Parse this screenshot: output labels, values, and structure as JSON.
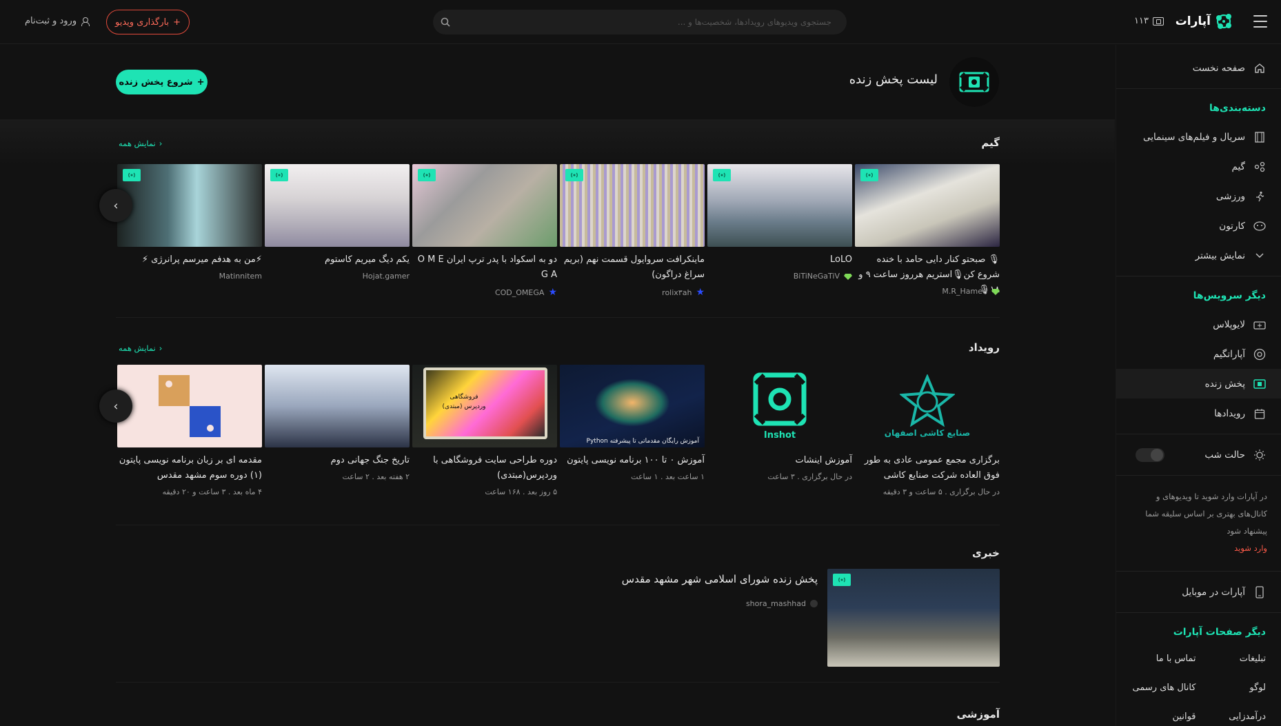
{
  "header": {
    "logo_text": "آپارات",
    "live_count": "۱۱۳",
    "search_placeholder": "جستجوی ویدیوهای رویدادها، شخصیت‌ها و ...",
    "upload_label": "بارگذاری ویدیو",
    "login_label": "ورود و ثبت‌نام"
  },
  "sidebar": {
    "home": "صفحه نخست",
    "categories_heading": "دسته‌بندی‌ها",
    "categories": [
      "سریال و فیلم‌های سینمایی",
      "گیم",
      "ورزشی",
      "کارتون"
    ],
    "show_more": "نمایش بیشتر",
    "services_heading": "دیگر سرویس‌ها",
    "services": [
      "لایوپلاس",
      "آپاراتگیم",
      "پخش زنده",
      "رویدادها"
    ],
    "dark_mode": "حالت شب",
    "note": "در آپارات وارد شوید تا ویدیوهای و کانال‌های بهتری بر اساس سلیقه شما پیشنهاد شود",
    "note_login": "وارد شوید",
    "mobile": "آپارات در موبایل",
    "pages_heading": "دیگر صفحات آپارات",
    "pages": [
      "تبلیغات",
      "تماس با ما",
      "لوگو",
      "کانال های رسمی",
      "درآمدزایی",
      "قوانین"
    ]
  },
  "page": {
    "title": "لیست پخش زنده",
    "start_live": "شروع پخش زنده",
    "show_all": "نمایش همه"
  },
  "sections": {
    "game": {
      "title": "گیم",
      "cards": [
        {
          "title": "🎙 صبحتو کنار دایی حامد با خنده شروع کن🎙استریم هرروز ساعت ۹ و ۱۸🎙",
          "channel": "M.R_Hamed",
          "badge": "gem"
        },
        {
          "title": "LoLO",
          "channel": "BiTiNeGaTiV",
          "badge": "gem"
        },
        {
          "title": "ماینکرافت سروایول قسمت نهم (بریم سراغ دراگون)",
          "channel": "rolix۳ah",
          "badge": "star"
        },
        {
          "title": "دو به اسکواد با پدر ترپ ایران O M E G A",
          "channel": "COD_OMEGA",
          "badge": "star"
        },
        {
          "title": "یکم دیگ میریم کاستوم",
          "channel": "Hojat.gamer",
          "badge": ""
        },
        {
          "title": "⚡من به هدفم میرسم پرانرژی ⚡",
          "channel": "Matinnitem",
          "badge": ""
        }
      ]
    },
    "event": {
      "title": "رویداد",
      "cards": [
        {
          "title": "برگزاری مجمع عمومی عادی به طور فوق العاده شرکت صنایع کاشی",
          "meta": "در حال برگزاری  .  ۵ ساعت و ۳ دقیقه",
          "thumb_text": "صنایع کاشی اصفهان"
        },
        {
          "title": "آموزش اینشات",
          "meta": "در حال برگزاری  .  ۳ ساعت",
          "thumb_text": "Inshot"
        },
        {
          "title": "آموزش ۰ تا ۱۰۰ برنامه نویسی پایتون",
          "meta": "۱ ساعت بعد  .  ۱ ساعت",
          "thumb_text": "آموزش رایگان مقدماتی تا پیشرفته Python"
        },
        {
          "title": "دوره طراحی سایت فروشگاهی با وردپرس(مبتدی)",
          "meta": "۵ روز بعد  .  ۱۶۸ ساعت",
          "thumb_text": "فروشگاهی وردپرس (مبتدی)"
        },
        {
          "title": "تاریخ جنگ جهانی دوم",
          "meta": "۲ هفته بعد  .  ۲ ساعت",
          "thumb_text": ""
        },
        {
          "title": "مقدمه ای بر زبان برنامه نویسی پایتون (۱) دوره سوم مشهد مقدس",
          "meta": "۴ ماه بعد  .  ۳ ساعت و ۲۰ دقیقه",
          "thumb_text": ""
        }
      ]
    },
    "news": {
      "title": "خبری",
      "card": {
        "title": "پخش زنده شورای اسلامی شهر مشهد مقدس",
        "channel": "shora_mashhad"
      }
    },
    "education": {
      "title": "آموزشی"
    }
  },
  "colors": {
    "accent": "#1ee3b4",
    "upload": "#e24a3b",
    "background": "#121212"
  }
}
